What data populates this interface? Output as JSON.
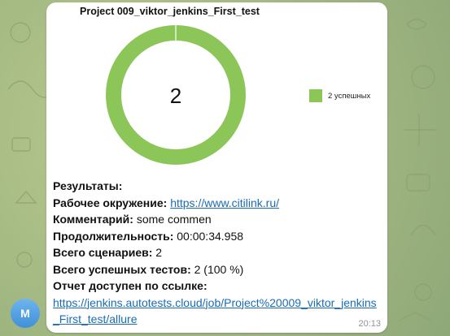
{
  "chart": {
    "title": "Project 009_viktor_jenkins_First_test",
    "center_label": "2",
    "legend_label": "2 успешных"
  },
  "chart_data": {
    "type": "pie",
    "title": "Project 009_viktor_jenkins_First_test",
    "donut": true,
    "categories": [
      "2 успешных"
    ],
    "values": [
      2
    ],
    "colors": [
      "#8cc558"
    ],
    "legend_placement": "right"
  },
  "message": {
    "results_heading": "Результаты:",
    "env_label": "Рабочее окружение:",
    "env_link": "https://www.citilink.ru/",
    "comment_label": "Комментарий:",
    "comment_value": "some commen",
    "duration_label": "Продолжительность:",
    "duration_value": "00:00:34.958",
    "scenarios_label": "Всего сценариев:",
    "scenarios_value": "2",
    "passed_label": "Всего успешных тестов:",
    "passed_value": "2 (100 %)",
    "report_label": "Отчет доступен по ссылке:",
    "report_link": "https://jenkins.autotests.cloud/job/Project%20009_viktor_jenkins_First_test/allure",
    "time": "20:13"
  },
  "sender": {
    "avatar_letter": "M"
  },
  "colors": {
    "accent": "#8cc558",
    "link": "#1a6bb5",
    "avatar": "#4a9be0"
  }
}
